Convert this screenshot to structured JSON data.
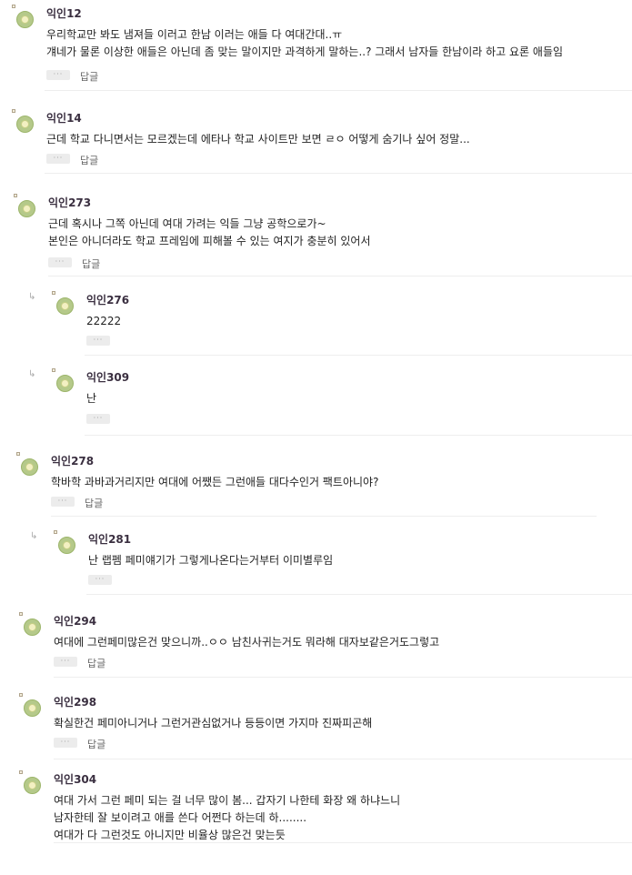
{
  "more_label": "···",
  "reply_label": "답글",
  "comments": [
    {
      "name": "익인12",
      "lines": [
        "우리학교만 봐도 냄져들 이러고 한남 이러는 애들 다 여대간대..ㅠ",
        "걔네가 물론 이상한 애들은 아닌데 좀 맞는 말이지만 과격하게 말하는..? 그래서 남자들 한남이라 하고 요론 애들임"
      ],
      "has_reply": true
    },
    {
      "name": "익인14",
      "lines": [
        "근데 학교 다니면서는 모르겠는데 에타나 학교 사이트만 보면 ㄹㅇ 어떻게 숨기나 싶어 정말..."
      ],
      "has_reply": true
    },
    {
      "name": "익인273",
      "lines": [
        "근데 혹시나 그쪽 아닌데 여대 가려는 익들 그냥 공학으로가~",
        "본인은 아니더라도 학교 프레임에 피해볼 수 있는 여지가 충분히 있어서"
      ],
      "has_reply": true
    },
    {
      "name": "익인276",
      "lines": [
        "22222"
      ],
      "has_reply": false
    },
    {
      "name": "익인309",
      "lines": [
        "난"
      ],
      "has_reply": false
    },
    {
      "name": "익인278",
      "lines": [
        "학바학 과바과거리지만 여대에 어쨌든 그런애들 대다수인거 팩트아니야?"
      ],
      "has_reply": true
    },
    {
      "name": "익인281",
      "lines": [
        "난 랩펨 페미얘기가 그렇게나온다는거부터 이미별루임"
      ],
      "has_reply": false
    },
    {
      "name": "익인294",
      "lines": [
        "여대에 그런페미많은건 맞으니까..ㅇㅇ 남친사귀는거도 뭐라해 대자보같은거도그렇고"
      ],
      "has_reply": true
    },
    {
      "name": "익인298",
      "lines": [
        "확실한건 페미아니거나 그런거관심없거나 등등이면 가지마 진짜피곤해"
      ],
      "has_reply": true
    },
    {
      "name": "익인304",
      "lines": [
        "여대 가서 그런 페미 되는 걸 너무 많이 봄... 갑자기 나한테 화장 왜 하냐느니",
        "남자한테 잘 보이려고 애를 쓴다 어쩐다 하는데 하........",
        "여대가 다 그런것도 아니지만 비율상 많은건 맞는듯"
      ],
      "has_reply": false
    }
  ]
}
